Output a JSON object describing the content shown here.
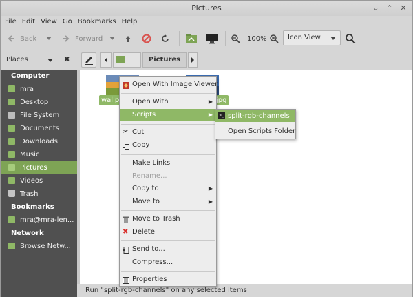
{
  "window": {
    "title": "Pictures",
    "controls": [
      "⌄",
      "⌃",
      "✕"
    ]
  },
  "menubar": [
    "File",
    "Edit",
    "View",
    "Go",
    "Bookmarks",
    "Help"
  ],
  "toolbar": {
    "back_label": "Back",
    "forward_label": "Forward",
    "zoom_level": "100%",
    "view_mode": "Icon View"
  },
  "location": {
    "places_label": "Places",
    "close_label": "✖",
    "path": [
      "mra",
      "Pictures"
    ]
  },
  "sidebar": {
    "sections": [
      {
        "heading": "Computer",
        "items": [
          {
            "label": "mra",
            "icon": "home-folder-icon"
          },
          {
            "label": "Desktop",
            "icon": "desktop-folder-icon"
          },
          {
            "label": "File System",
            "icon": "drive-icon"
          },
          {
            "label": "Documents",
            "icon": "folder-icon"
          },
          {
            "label": "Downloads",
            "icon": "folder-icon"
          },
          {
            "label": "Music",
            "icon": "folder-icon"
          },
          {
            "label": "Pictures",
            "icon": "folder-icon",
            "active": true
          },
          {
            "label": "Videos",
            "icon": "folder-icon"
          },
          {
            "label": "Trash",
            "icon": "trash-icon"
          }
        ]
      },
      {
        "heading": "Bookmarks",
        "items": [
          {
            "label": "mra@mra-len...",
            "icon": "folder-icon"
          }
        ]
      },
      {
        "heading": "Network",
        "items": [
          {
            "label": "Browse Netw...",
            "icon": "network-icon"
          }
        ]
      }
    ]
  },
  "files": [
    {
      "label": "wallpa",
      "selected": true
    },
    {
      "label": "jpg",
      "selected": true
    }
  ],
  "context_menu": {
    "items": [
      {
        "label": "Open With Image Viewer",
        "icon": "image-viewer-icon"
      },
      {
        "label": "Open With",
        "submenu": true
      },
      {
        "label": "Scripts",
        "submenu": true,
        "highlighted": true
      },
      {
        "label": "Cut",
        "icon": "scissors-icon"
      },
      {
        "label": "Copy",
        "icon": "copy-icon"
      },
      {
        "label": "Make Links"
      },
      {
        "label": "Rename...",
        "disabled": true
      },
      {
        "label": "Copy to",
        "submenu": true
      },
      {
        "label": "Move to",
        "submenu": true
      },
      {
        "label": "Move to Trash",
        "icon": "trash-icon"
      },
      {
        "label": "Delete",
        "icon": "delete-icon"
      },
      {
        "label": "Send to...",
        "icon": "send-icon"
      },
      {
        "label": "Compress..."
      },
      {
        "label": "Properties",
        "icon": "properties-icon"
      }
    ]
  },
  "scripts_submenu": {
    "items": [
      {
        "label": "split-rgb-channels",
        "icon": "terminal-icon",
        "highlighted": true
      },
      {
        "label": "Open Scripts Folder"
      }
    ]
  },
  "statusbar": {
    "text": "Run \"split-rgb-channels\" on any selected items"
  },
  "colors": {
    "accent": "#8fb866",
    "sidebar_bg": "#505050",
    "active_item": "#7ea455"
  }
}
